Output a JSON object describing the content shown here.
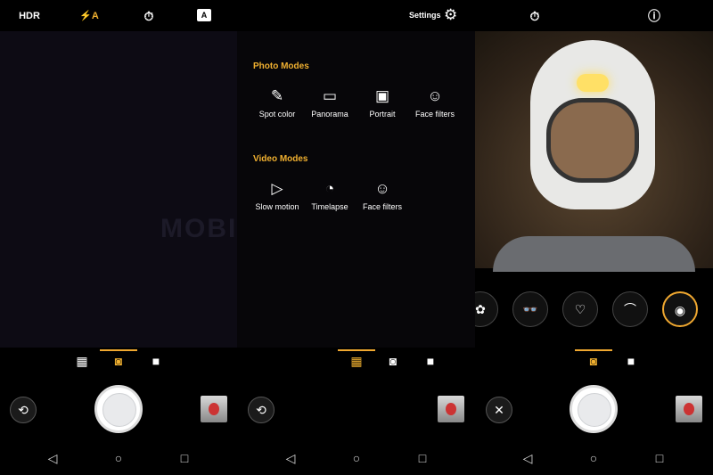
{
  "watermark": "MOBIGYAAN",
  "accent": "#f0b030",
  "panel1": {
    "top_icons": [
      {
        "name": "hdr-icon",
        "label": "HDR"
      },
      {
        "name": "flash-auto-icon",
        "label": "⚡A"
      },
      {
        "name": "timer-off-icon",
        "label": "⏱"
      },
      {
        "name": "auto-mode-icon",
        "label": "A"
      }
    ],
    "modes": [
      "grid-icon",
      "camera-icon",
      "video-icon"
    ],
    "active_mode": "camera"
  },
  "panel2": {
    "settings_label": "Settings",
    "photo_modes_title": "Photo Modes",
    "photo_modes": [
      {
        "icon": "✎",
        "label": "Spot color"
      },
      {
        "icon": "▭",
        "label": "Panorama"
      },
      {
        "icon": "▣",
        "label": "Portrait"
      },
      {
        "icon": "☺",
        "label": "Face filters"
      }
    ],
    "video_modes_title": "Video Modes",
    "video_modes": [
      {
        "icon": "▷",
        "label": "Slow motion"
      },
      {
        "icon": "◔",
        "label": "Timelapse"
      },
      {
        "icon": "☺",
        "label": "Face filters"
      }
    ],
    "active_mode": "grid"
  },
  "panel3": {
    "filters": [
      "flower-filter",
      "sunglasses-filter",
      "heart-glasses-filter",
      "hat-filter",
      "astronaut-helmet-filter"
    ],
    "selected_filter": "astronaut-helmet-filter",
    "active_mode": "camera"
  },
  "nav": {
    "back": "◁",
    "home": "○",
    "recents": "□"
  }
}
